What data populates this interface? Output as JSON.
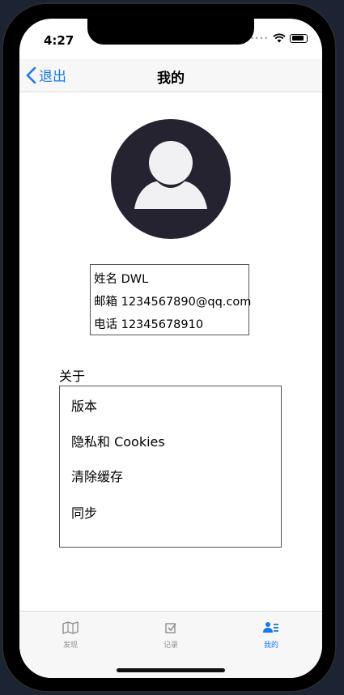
{
  "status": {
    "time": "4:27"
  },
  "nav": {
    "back_label": "退出",
    "title": "我的"
  },
  "profile": {
    "name_line": "姓名 DWL",
    "email_line": "邮箱 1234567890@qq.com",
    "phone_line": "电话 12345678910"
  },
  "about": {
    "label": "关于",
    "items": [
      "版本",
      "隐私和 Cookies",
      "清除缓存",
      "同步"
    ]
  },
  "tabs": [
    {
      "label": "发现",
      "icon": "map-icon",
      "active": false
    },
    {
      "label": "记录",
      "icon": "checkbox-icon",
      "active": false
    },
    {
      "label": "我的",
      "icon": "user-list-icon",
      "active": true
    }
  ],
  "colors": {
    "accent": "#1479f6",
    "inactive": "#8e8e93",
    "avatar": "#25232f"
  }
}
